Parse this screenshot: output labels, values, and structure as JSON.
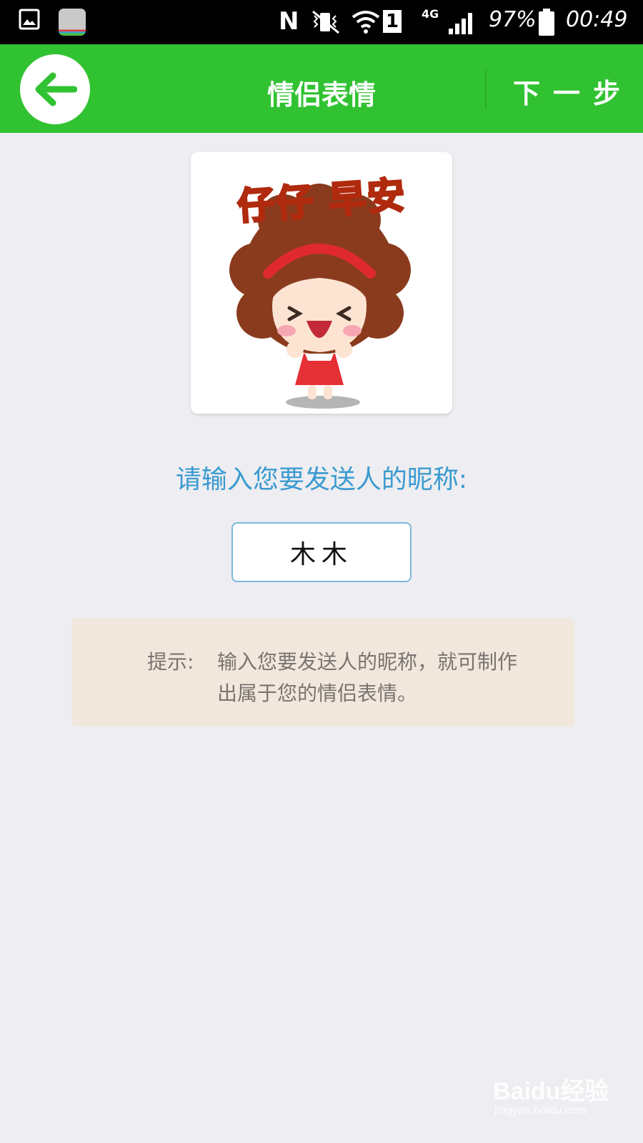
{
  "status_bar": {
    "icons": [
      "gallery-notification-icon",
      "sticker-app-notification-icon",
      "nfc-icon",
      "vibrate-mute-icon",
      "wifi-icon",
      "signal-icon",
      "battery-icon"
    ],
    "nfc_label": "N",
    "sim_slot": "1",
    "network_type": "4G",
    "battery_percent": "97%",
    "time": "00:49"
  },
  "header": {
    "background_color": "#31c232",
    "back_icon": "arrow-left-icon",
    "title": "情侣表情",
    "next_label": "下一步"
  },
  "sticker": {
    "caption": "仔仔 早安",
    "illustration": "cartoon girl with brown afro hair, red headband and red dress"
  },
  "form": {
    "prompt": "请输入您要发送人的昵称:",
    "nickname_value": "木木",
    "accent_color": "#3a9bd0"
  },
  "tip": {
    "label": "提示:",
    "text": "输入您要发送人的昵称，就可制作出属于您的情侣表情。"
  },
  "watermark": {
    "logo": "Baidu经验",
    "url": "jingyan.baidu.com"
  }
}
